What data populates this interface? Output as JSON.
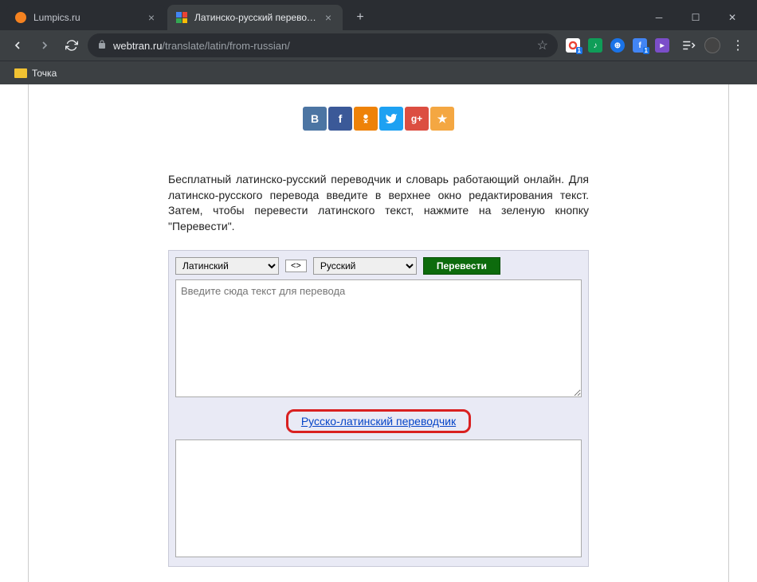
{
  "window": {
    "tabs": [
      {
        "title": "Lumpics.ru",
        "active": false
      },
      {
        "title": "Латинско-русский переводчик",
        "active": true
      }
    ]
  },
  "nav": {
    "url_domain": "webtran.ru",
    "url_path": "/translate/latin/from-russian/"
  },
  "bookmarks": {
    "item1": "Точка"
  },
  "page": {
    "paragraph": "Бесплатный латинско-русский переводчик и словарь работающий онлайн. Для латинско-русского перевода введите в верхнее окно редактирования текст. Затем, чтобы перевести латинского текст, нажмите на зеленую кнопку \"Перевести\".",
    "lang_from": "Латинский",
    "lang_to": "Русский",
    "swap_label": "<>",
    "translate_label": "Перевести",
    "input_placeholder": "Введите сюда текст для перевода",
    "reverse_link": "Русско-латинский переводчик"
  },
  "social": {
    "vk": "B",
    "fb": "f",
    "ok": "",
    "tw": "",
    "gp": "g+",
    "fav": "★"
  }
}
